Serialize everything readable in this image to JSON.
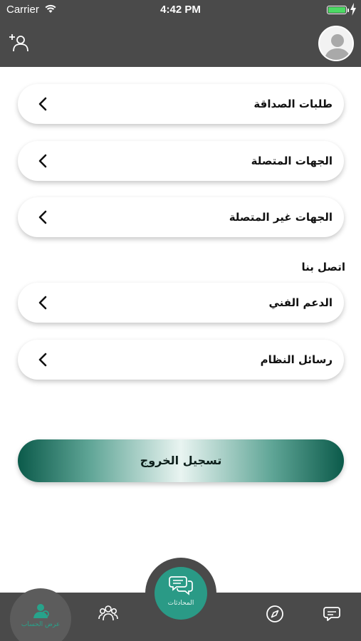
{
  "status_bar": {
    "carrier": "Carrier",
    "time": "4:42 PM"
  },
  "header": {
    "add_friend_icon": "add-friend-icon",
    "avatar_icon": "user-avatar"
  },
  "menu": [
    {
      "label": "طلبات الصداقة"
    },
    {
      "label": "الجهات المتصلة"
    },
    {
      "label": "الجهات غير المتصلة"
    }
  ],
  "contact_section": {
    "title": "اتصل بنا",
    "items": [
      {
        "label": "الدعم الفني"
      },
      {
        "label": "رسائل النظام"
      }
    ]
  },
  "logout": {
    "label": "تسجيل الخروج"
  },
  "tabbar": {
    "center": {
      "label": "المحادثات",
      "icon": "chat-bubbles-icon"
    },
    "tabs": [
      {
        "label": "عرض الحساب",
        "icon": "profile-icon"
      },
      {
        "label": "",
        "icon": "groups-icon"
      },
      {
        "label": "",
        "icon": "compass-icon"
      },
      {
        "label": "",
        "icon": "chat-icon"
      }
    ]
  },
  "colors": {
    "header": "#4a4a4a",
    "accent": "#2a9a86",
    "logout_dark": "#0b5a4a",
    "battery": "#4cd964"
  }
}
